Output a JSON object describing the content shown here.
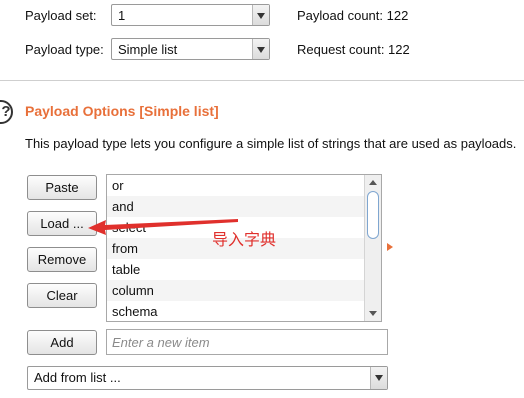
{
  "payload_set": {
    "label": "Payload set:",
    "value": "1"
  },
  "payload_type": {
    "label": "Payload type:",
    "value": "Simple list"
  },
  "payload_count": "Payload count:  122",
  "request_count": "Request count:  122",
  "section": {
    "help_glyph": "?",
    "title": "Payload Options [Simple list]",
    "description": "This payload type lets you configure a simple list of strings that are used as payloads."
  },
  "buttons": {
    "paste": "Paste",
    "load": "Load ...",
    "remove": "Remove",
    "clear": "Clear",
    "add": "Add"
  },
  "list_items": [
    "or",
    "and",
    "select",
    "from",
    "table",
    "column",
    "schema"
  ],
  "annotation": "导入字典",
  "new_item_placeholder": "Enter a new item",
  "add_from_list": "Add from list ...",
  "colors": {
    "section_title": "#e8703a",
    "annotation": "#e0302c"
  }
}
